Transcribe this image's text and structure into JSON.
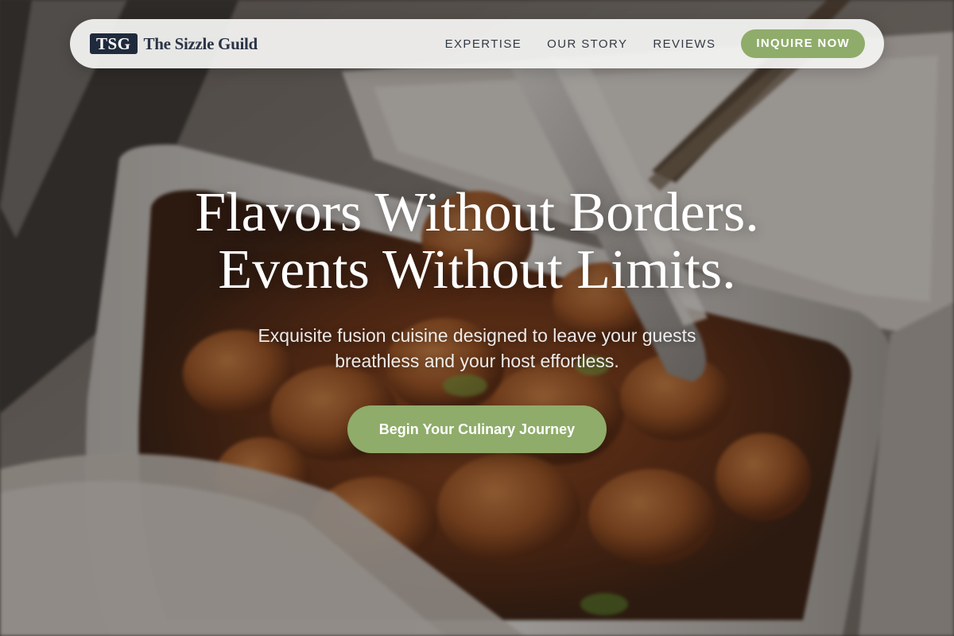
{
  "nav": {
    "logo_mark": "TSG",
    "brand_name": "The Sizzle Guild",
    "links": [
      "EXPERTISE",
      "OUR STORY",
      "REVIEWS"
    ],
    "cta_label": "INQUIRE NOW"
  },
  "hero": {
    "headline_line1": "Flavors Without Borders.",
    "headline_line2": "Events Without Limits.",
    "subtitle": "Exquisite fusion cuisine designed to leave your guests breathless and your host effortless.",
    "cta_label": "Begin Your Culinary Journey",
    "background_image": "Food in a steel chafing dish with serving tongs"
  },
  "colors": {
    "accent": "#8fac6a",
    "logo_bg": "#1f2a3d",
    "nav_text": "#333a45",
    "brand_text": "#2a3446"
  }
}
